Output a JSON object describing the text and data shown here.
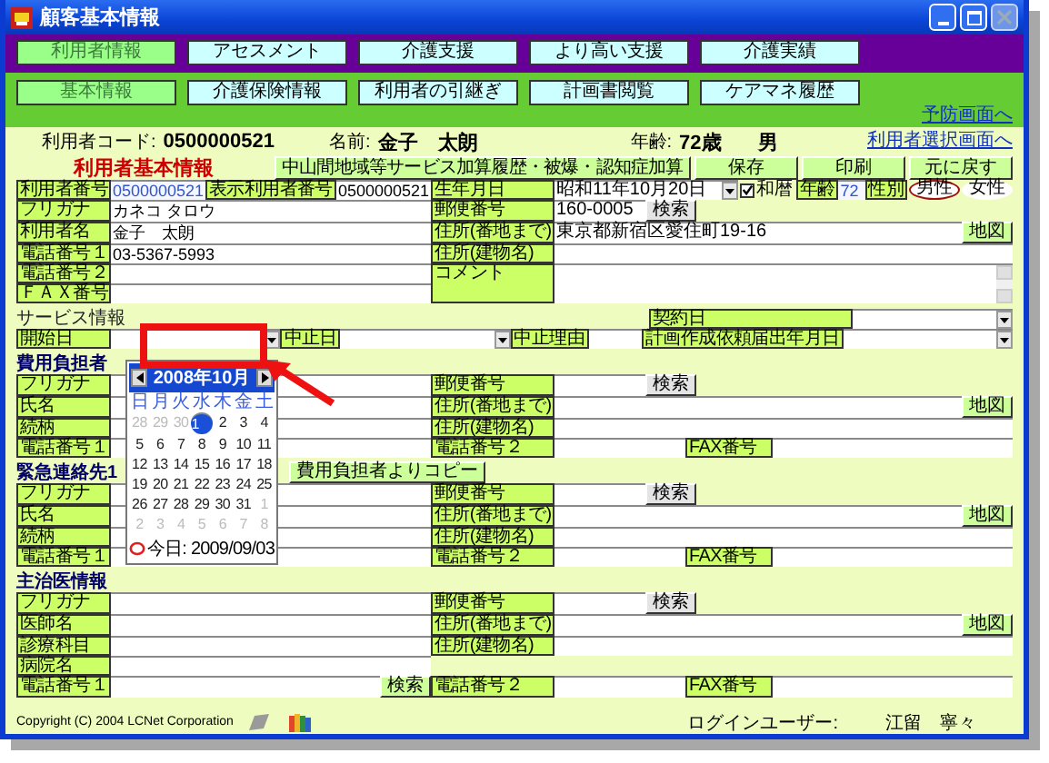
{
  "window": {
    "title": "顧客基本情報"
  },
  "main_tabs": [
    {
      "label": "利用者情報",
      "selected": true
    },
    {
      "label": "アセスメント",
      "selected": false
    },
    {
      "label": "介護支援",
      "selected": false
    },
    {
      "label": "より高い支援",
      "selected": false
    },
    {
      "label": "介護実績",
      "selected": false
    }
  ],
  "sub_tabs": [
    {
      "label": "基本情報",
      "selected": true
    },
    {
      "label": "介護保険情報",
      "selected": false
    },
    {
      "label": "利用者の引継ぎ",
      "selected": false
    },
    {
      "label": "計画書閲覧",
      "selected": false
    },
    {
      "label": "ケアマネ履歴",
      "selected": false
    }
  ],
  "prevention_link": "予防画面へ",
  "header": {
    "code_label": "利用者コード:",
    "code": "0500000521",
    "name_label": "名前:",
    "name": "金子　太朗",
    "age_label": "年齢:",
    "age": "72歳",
    "sex": "男",
    "select_link": "利用者選択画面へ"
  },
  "basic": {
    "title": "利用者基本情報",
    "buttons": [
      "中山間地域等サービス加算履歴・被爆・認知症加算",
      "保存",
      "印刷",
      "元に戻す"
    ],
    "rows": [
      {
        "left": [
          {
            "kind": "label",
            "text": "利用者番号"
          },
          {
            "kind": "field",
            "value": "0500000521",
            "locked": true
          },
          {
            "kind": "label",
            "text": "表示利用者番号"
          },
          {
            "kind": "field",
            "value": "0500000521"
          }
        ],
        "right": [
          {
            "kind": "label",
            "text": "生年月日"
          },
          {
            "kind": "select",
            "value": "昭和11年10月20日"
          },
          {
            "kind": "checkbox",
            "label": "和暦",
            "checked": true
          },
          {
            "kind": "label",
            "text": "年齢"
          },
          {
            "kind": "field",
            "value": "72",
            "locked": true
          },
          {
            "kind": "label",
            "text": "性別"
          },
          {
            "kind": "radio",
            "options": [
              {
                "label": "男性",
                "selected": true
              },
              {
                "label": "女性",
                "selected": false
              }
            ]
          }
        ]
      },
      {
        "left": [
          {
            "kind": "label",
            "text": "フリガナ"
          },
          {
            "kind": "field",
            "value": "カネコ タロウ"
          }
        ],
        "right": [
          {
            "kind": "label",
            "text": "郵便番号"
          },
          {
            "kind": "field",
            "value": "160-0005"
          },
          {
            "kind": "greybutton",
            "label": "検索"
          }
        ]
      },
      {
        "left": [
          {
            "kind": "label",
            "text": "利用者名"
          },
          {
            "kind": "field",
            "value": "金子　太朗"
          }
        ],
        "right": [
          {
            "kind": "label",
            "text": "住所(番地まで)"
          },
          {
            "kind": "field",
            "value": "東京都新宿区愛住町19-16"
          },
          {
            "kind": "button",
            "label": "地図"
          }
        ]
      },
      {
        "left": [
          {
            "kind": "label",
            "text": "電話番号１"
          },
          {
            "kind": "field",
            "value": "03-5367-5993"
          }
        ],
        "right": [
          {
            "kind": "label",
            "text": "住所(建物名)"
          },
          {
            "kind": "field"
          }
        ]
      },
      {
        "left_lines": [
          [
            {
              "kind": "label",
              "text": "電話番号２"
            },
            {
              "kind": "field"
            }
          ],
          [
            {
              "kind": "label",
              "text": "ＦＡＸ番号"
            },
            {
              "kind": "field"
            }
          ]
        ],
        "right": [
          {
            "kind": "label",
            "text": "コメント"
          },
          {
            "kind": "textarea"
          }
        ]
      }
    ]
  },
  "service": {
    "title": "サービス情報",
    "contract": [
      {
        "kind": "label",
        "text": "契約日"
      },
      {
        "kind": "select"
      }
    ],
    "rows": [
      {
        "cells": [
          {
            "kind": "label",
            "text": "開始日"
          },
          {
            "kind": "select"
          },
          {
            "kind": "label",
            "text": "中止日"
          },
          {
            "kind": "select"
          },
          {
            "kind": "label",
            "text": "中止理由"
          },
          {
            "kind": "field"
          },
          {
            "kind": "label",
            "text": "計画作成依頼届出年月日"
          },
          {
            "kind": "select"
          }
        ]
      }
    ]
  },
  "payer": {
    "title": "費用負担者",
    "rows": [
      {
        "left": [
          {
            "kind": "label",
            "text": "フリガナ"
          },
          {
            "kind": "field"
          }
        ],
        "right": [
          {
            "kind": "label",
            "text": "郵便番号"
          },
          {
            "kind": "field"
          },
          {
            "kind": "greybutton",
            "label": "検索"
          }
        ]
      },
      {
        "left": [
          {
            "kind": "label",
            "text": "氏名"
          },
          {
            "kind": "field"
          }
        ],
        "right": [
          {
            "kind": "label",
            "text": "住所(番地まで)"
          },
          {
            "kind": "field"
          },
          {
            "kind": "button",
            "label": "地図"
          }
        ]
      },
      {
        "left": [
          {
            "kind": "label",
            "text": "続柄"
          },
          {
            "kind": "field"
          }
        ],
        "right": [
          {
            "kind": "label",
            "text": "住所(建物名)"
          },
          {
            "kind": "field"
          }
        ]
      },
      {
        "left": [
          {
            "kind": "label",
            "text": "電話番号１"
          },
          {
            "kind": "field"
          }
        ],
        "right": [
          {
            "kind": "label",
            "text": "電話番号２"
          },
          {
            "kind": "field"
          }
        ],
        "extra": [
          {
            "kind": "label",
            "text": "FAX番号"
          },
          {
            "kind": "field"
          }
        ]
      }
    ]
  },
  "emergency": {
    "title": "緊急連絡先1",
    "copy_button": "費用負担者よりコピー",
    "rows": [
      {
        "left": [
          {
            "kind": "label",
            "text": "フリガナ"
          },
          {
            "kind": "field"
          }
        ],
        "right": [
          {
            "kind": "label",
            "text": "郵便番号"
          },
          {
            "kind": "field"
          },
          {
            "kind": "greybutton",
            "label": "検索"
          }
        ]
      },
      {
        "left": [
          {
            "kind": "label",
            "text": "氏名"
          },
          {
            "kind": "field"
          }
        ],
        "right": [
          {
            "kind": "label",
            "text": "住所(番地まで)"
          },
          {
            "kind": "field"
          },
          {
            "kind": "button",
            "label": "地図"
          }
        ]
      },
      {
        "left": [
          {
            "kind": "label",
            "text": "続柄"
          },
          {
            "kind": "field"
          }
        ],
        "right": [
          {
            "kind": "label",
            "text": "住所(建物名)"
          },
          {
            "kind": "field"
          }
        ]
      },
      {
        "left": [
          {
            "kind": "label",
            "text": "電話番号１"
          },
          {
            "kind": "field"
          }
        ],
        "right": [
          {
            "kind": "label",
            "text": "電話番号２"
          },
          {
            "kind": "field"
          }
        ],
        "extra": [
          {
            "kind": "label",
            "text": "FAX番号"
          },
          {
            "kind": "field"
          }
        ]
      }
    ]
  },
  "doctor": {
    "title": "主治医情報",
    "rows": [
      {
        "left": [
          {
            "kind": "label",
            "text": "フリガナ"
          },
          {
            "kind": "field"
          }
        ],
        "right": [
          {
            "kind": "label",
            "text": "郵便番号"
          },
          {
            "kind": "field"
          },
          {
            "kind": "greybutton",
            "label": "検索"
          }
        ]
      },
      {
        "left": [
          {
            "kind": "label",
            "text": "医師名"
          },
          {
            "kind": "field"
          }
        ],
        "right": [
          {
            "kind": "label",
            "text": "住所(番地まで)"
          },
          {
            "kind": "field"
          },
          {
            "kind": "button",
            "label": "地図"
          }
        ]
      },
      {
        "left": [
          {
            "kind": "label",
            "text": "診療科目"
          },
          {
            "kind": "field"
          }
        ],
        "right": [
          {
            "kind": "label",
            "text": "住所(建物名)"
          },
          {
            "kind": "field"
          }
        ]
      },
      {
        "left": [
          {
            "kind": "label",
            "text": "病院名"
          },
          {
            "kind": "field"
          }
        ]
      },
      {
        "left": [
          {
            "kind": "label",
            "text": "電話番号１"
          },
          {
            "kind": "field"
          },
          {
            "kind": "button",
            "label": "検索"
          }
        ],
        "right": [
          {
            "kind": "label",
            "text": "電話番号２"
          },
          {
            "kind": "field"
          }
        ],
        "extra": [
          {
            "kind": "label",
            "text": "FAX番号"
          },
          {
            "kind": "field"
          }
        ]
      }
    ]
  },
  "calendar": {
    "month": "2008年10月",
    "weekdays": [
      "日",
      "月",
      "火",
      "水",
      "木",
      "金",
      "土"
    ],
    "days": [
      {
        "text": "28",
        "outside": true,
        "selected": false
      },
      {
        "text": "29",
        "outside": true,
        "selected": false
      },
      {
        "text": "30",
        "outside": true,
        "selected": false
      },
      {
        "text": "1",
        "outside": false,
        "selected": true
      },
      {
        "text": "2",
        "outside": false,
        "selected": false
      },
      {
        "text": "3",
        "outside": false,
        "selected": false
      },
      {
        "text": "4",
        "outside": false,
        "selected": false
      },
      {
        "text": "5",
        "outside": false,
        "selected": false
      },
      {
        "text": "6",
        "outside": false,
        "selected": false
      },
      {
        "text": "7",
        "outside": false,
        "selected": false
      },
      {
        "text": "8",
        "outside": false,
        "selected": false
      },
      {
        "text": "9",
        "outside": false,
        "selected": false
      },
      {
        "text": "10",
        "outside": false,
        "selected": false
      },
      {
        "text": "11",
        "outside": false,
        "selected": false
      },
      {
        "text": "12",
        "outside": false,
        "selected": false
      },
      {
        "text": "13",
        "outside": false,
        "selected": false
      },
      {
        "text": "14",
        "outside": false,
        "selected": false
      },
      {
        "text": "15",
        "outside": false,
        "selected": false
      },
      {
        "text": "16",
        "outside": false,
        "selected": false
      },
      {
        "text": "17",
        "outside": false,
        "selected": false
      },
      {
        "text": "18",
        "outside": false,
        "selected": false
      },
      {
        "text": "19",
        "outside": false,
        "selected": false
      },
      {
        "text": "20",
        "outside": false,
        "selected": false
      },
      {
        "text": "21",
        "outside": false,
        "selected": false
      },
      {
        "text": "22",
        "outside": false,
        "selected": false
      },
      {
        "text": "23",
        "outside": false,
        "selected": false
      },
      {
        "text": "24",
        "outside": false,
        "selected": false
      },
      {
        "text": "25",
        "outside": false,
        "selected": false
      },
      {
        "text": "26",
        "outside": false,
        "selected": false
      },
      {
        "text": "27",
        "outside": false,
        "selected": false
      },
      {
        "text": "28",
        "outside": false,
        "selected": false
      },
      {
        "text": "29",
        "outside": false,
        "selected": false
      },
      {
        "text": "30",
        "outside": false,
        "selected": false
      },
      {
        "text": "31",
        "outside": false,
        "selected": false
      },
      {
        "text": "1",
        "outside": true,
        "selected": false
      },
      {
        "text": "2",
        "outside": true,
        "selected": false
      },
      {
        "text": "3",
        "outside": true,
        "selected": false
      },
      {
        "text": "4",
        "outside": true,
        "selected": false
      },
      {
        "text": "5",
        "outside": true,
        "selected": false
      },
      {
        "text": "6",
        "outside": true,
        "selected": false
      },
      {
        "text": "7",
        "outside": true,
        "selected": false
      },
      {
        "text": "8",
        "outside": true,
        "selected": false
      }
    ],
    "today": "今日: 2009/09/03"
  },
  "footer": {
    "copyright": "Copyright (C) 2004 LCNet Corporation",
    "login_label": "ログインユーザー:",
    "user": "江留　寧々"
  }
}
